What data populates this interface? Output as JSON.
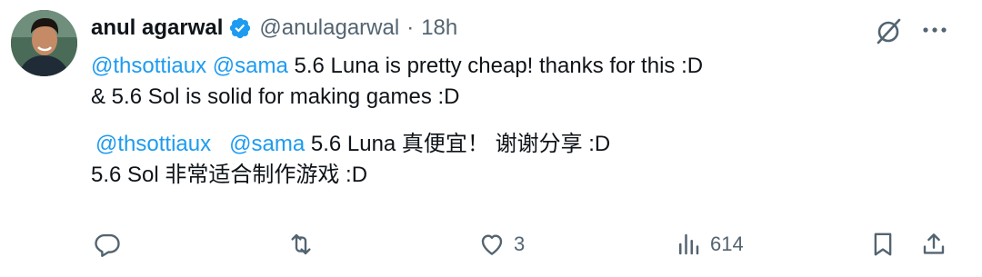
{
  "author": {
    "name": "anul agarwal",
    "handle": "@anulagarwal",
    "separator": "·",
    "time": "18h"
  },
  "tweet": {
    "en_line1": {
      "mention1": "@thsottiaux",
      "mention2": "@sama",
      "text": " 5.6 Luna is pretty cheap! thanks for this :D"
    },
    "en_line2": "& 5.6 Sol is solid for making games :D",
    "zh_line1": {
      "mention1": "@thsottiaux",
      "mention2": "@sama",
      "text": "  5.6 Luna 真便宜！ 谢谢分享 :D"
    },
    "zh_line2": "5.6 Sol 非常适合制作游戏 :D"
  },
  "actions": {
    "reply": {
      "icon": "reply-icon",
      "count": ""
    },
    "repost": {
      "icon": "repost-icon",
      "count": ""
    },
    "like": {
      "icon": "heart-icon",
      "count": "3"
    },
    "views": {
      "icon": "views-icon",
      "count": "614"
    },
    "bookmark": {
      "icon": "bookmark-icon"
    },
    "share": {
      "icon": "share-icon"
    }
  },
  "colors": {
    "text": "#0f1419",
    "secondary": "#536471",
    "mention": "#1d9bf0",
    "verified": "#1d9bf0"
  }
}
